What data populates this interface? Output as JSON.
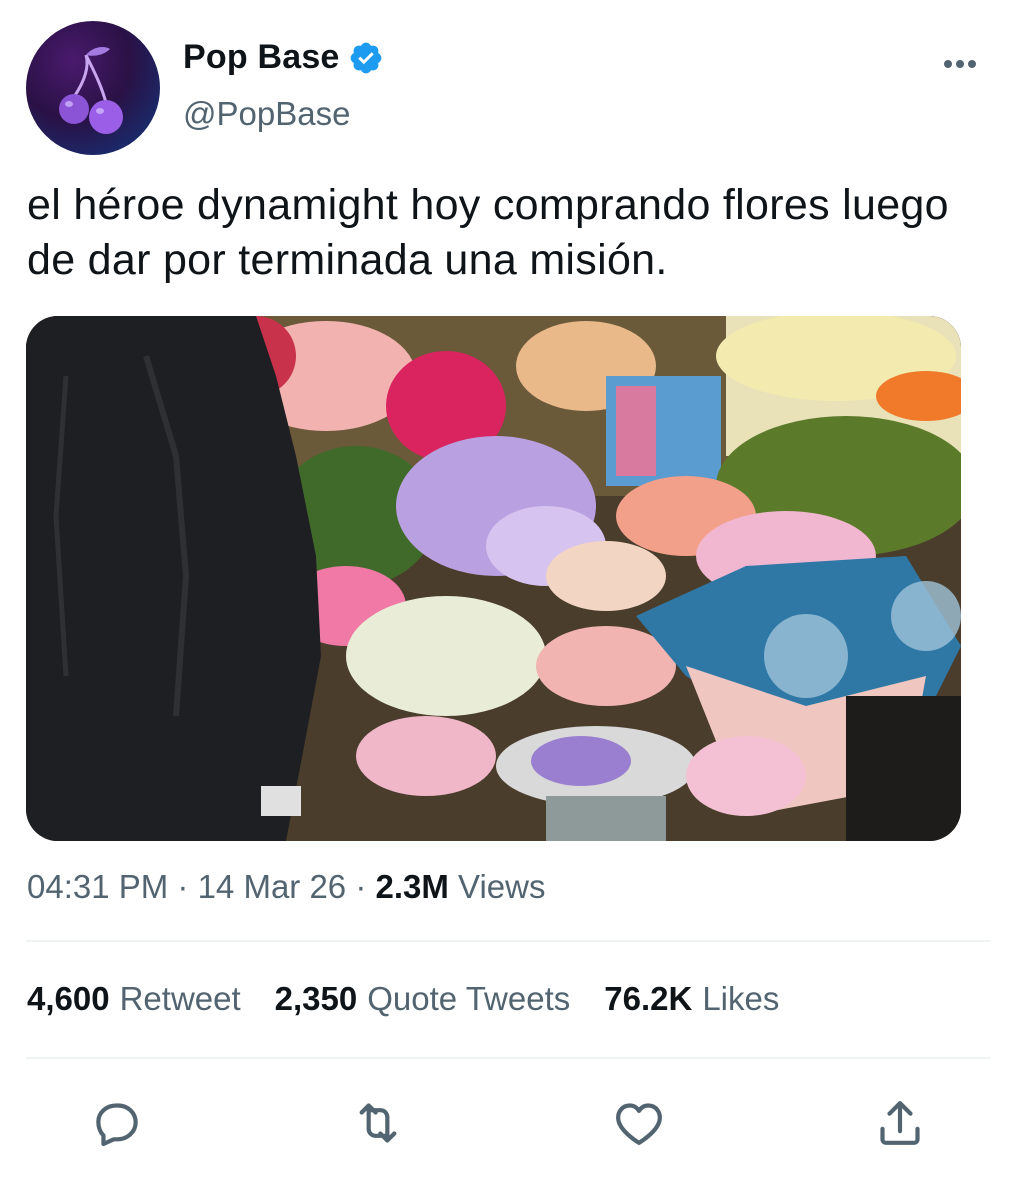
{
  "author": {
    "display_name": "Pop Base",
    "handle": "@PopBase",
    "verified": true,
    "avatar_icon": "cherry-icon",
    "verified_color": "#1d9bf0"
  },
  "tweet": {
    "text": "el héroe dynamight hoy comprando flores luego de dar por terminada una misión.",
    "image_alt": "flower-shop-photo"
  },
  "meta": {
    "time": "04:31 PM",
    "separator": " · ",
    "date": "14 Mar 26",
    "views_count": "2.3M",
    "views_label": "Views"
  },
  "stats": {
    "retweets": {
      "count": "4,600",
      "label": "Retweet"
    },
    "quotes": {
      "count": "2,350",
      "label": "Quote Tweets"
    },
    "likes": {
      "count": "76.2K",
      "label": "Likes"
    }
  },
  "actions": [
    "reply-icon",
    "retweet-icon",
    "like-icon",
    "share-icon"
  ],
  "colors": {
    "text": "#0f1419",
    "secondary": "#536471",
    "divider": "#eff3f4"
  }
}
